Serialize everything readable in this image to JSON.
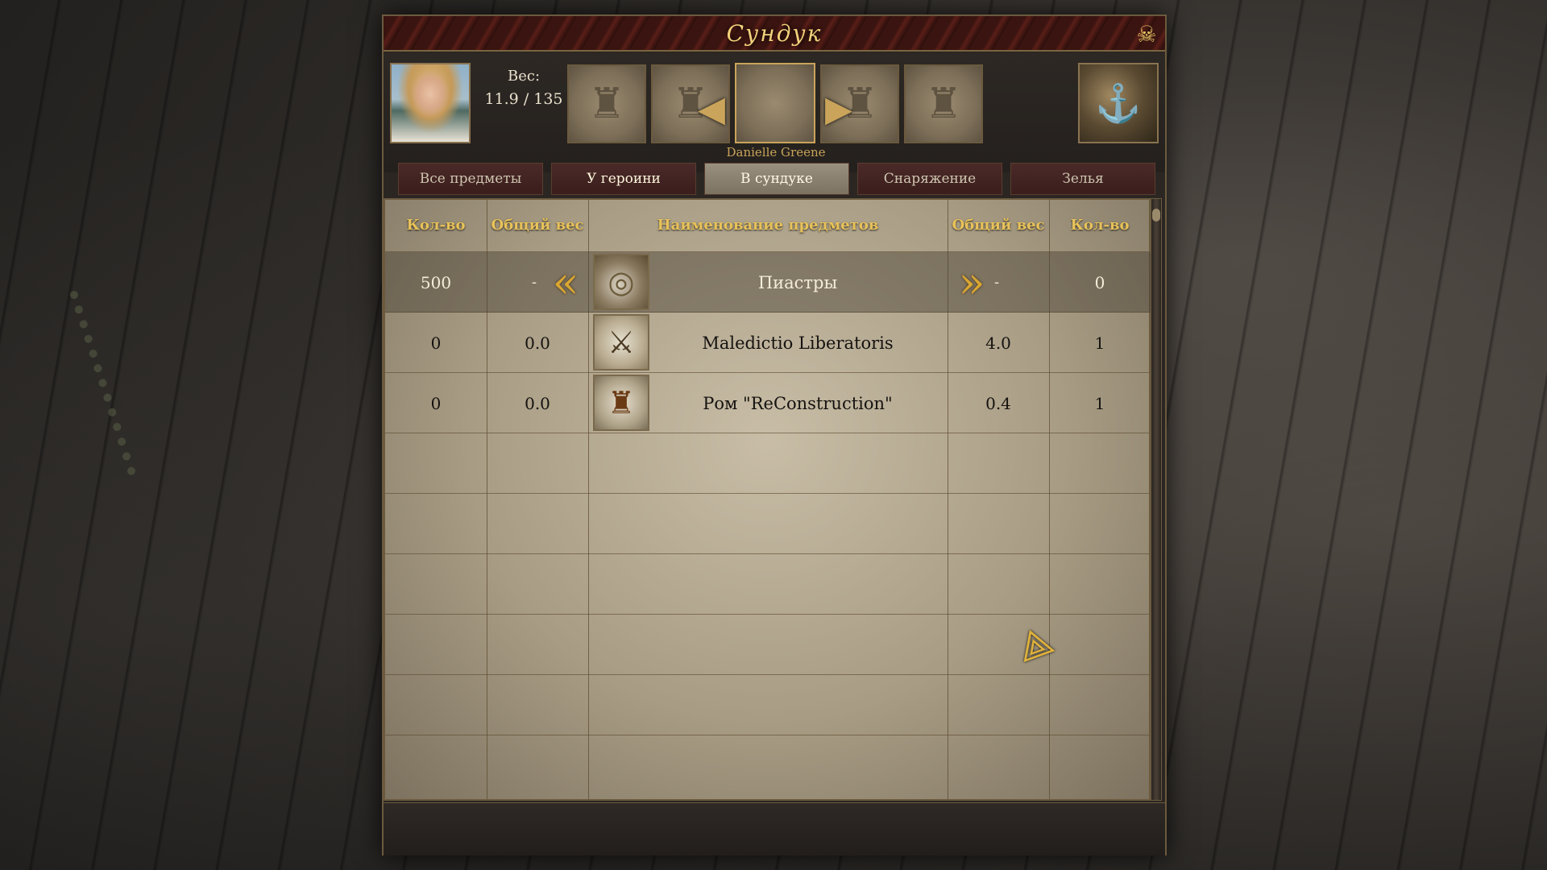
{
  "window": {
    "title": "Сундук",
    "close_icon": "skull-crossbones-icon"
  },
  "character": {
    "weight_label": "Вес:",
    "weight_value": "11.9 / 135",
    "name": "Danielle Greene",
    "slots": [
      {
        "icon": "officer-bust-icon",
        "glyph": "♜"
      },
      {
        "icon": "officer-bust-icon",
        "glyph": "♜"
      },
      {
        "icon": "heroine-portrait-icon"
      },
      {
        "icon": "officer-bust-icon",
        "glyph": "♜"
      },
      {
        "icon": "officer-bust-icon",
        "glyph": "♜"
      }
    ],
    "chest_icon": "treasure-chest-icon",
    "chest_glyph": "⚓"
  },
  "tabs": [
    {
      "label": "Все предметы",
      "selected": false
    },
    {
      "label": "У героини",
      "selected": false
    },
    {
      "label": "В сундуке",
      "selected": true
    },
    {
      "label": "Снаряжение",
      "selected": false
    },
    {
      "label": "Зелья",
      "selected": false
    }
  ],
  "table": {
    "headers": {
      "qty_left": "Кол-во",
      "weight_left": "Общий вес",
      "name": "Наименование предметов",
      "weight_right": "Общий вес",
      "qty_right": "Кол-во"
    },
    "rows": [
      {
        "qty_left": "500",
        "weight_left": "-",
        "name": "Пиастры",
        "weight_right": "-",
        "qty_right": "0",
        "icon": "coins-icon",
        "glyph": "◎",
        "highlight": true
      },
      {
        "qty_left": "0",
        "weight_left": "0.0",
        "name": "Maledictio Liberatoris",
        "weight_right": "4.0",
        "qty_right": "1",
        "icon": "sword-icon",
        "glyph": "⚔",
        "highlight": false
      },
      {
        "qty_left": "0",
        "weight_left": "0.0",
        "name": "Ром \"ReConstruction\"",
        "weight_right": "0.4",
        "qty_right": "1",
        "icon": "rum-bottle-icon",
        "glyph": "♜",
        "highlight": false
      }
    ],
    "arrows": {
      "left": "«",
      "right": "»"
    }
  },
  "colors": {
    "header_gold": "#e8c25a",
    "tab_active": "#9a9080",
    "tab_inactive": "#4a2a28",
    "title_gold": "#f2d27a"
  }
}
